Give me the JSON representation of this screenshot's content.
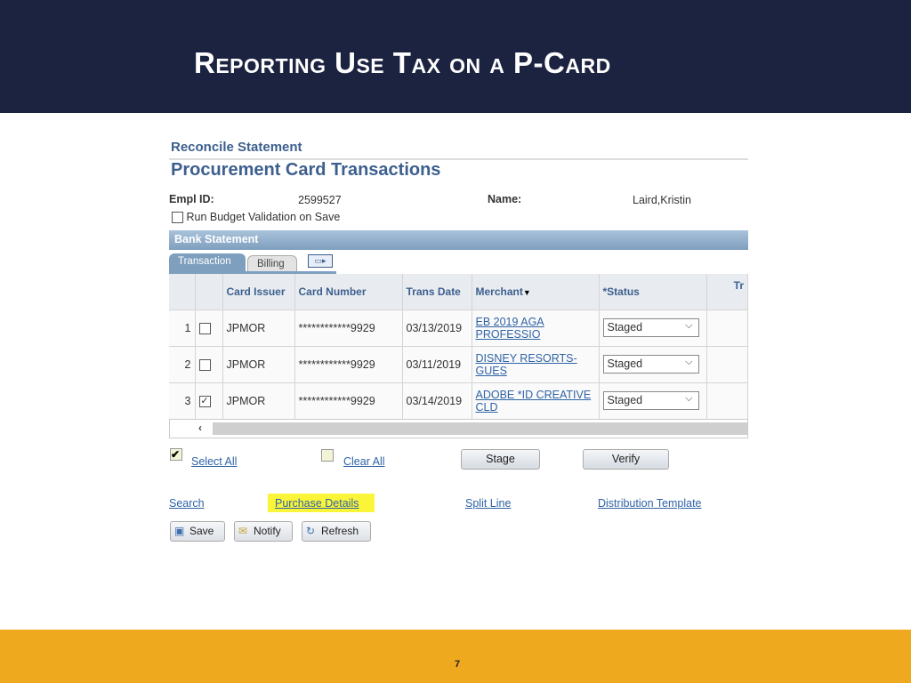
{
  "slide": {
    "title": "Reporting Use Tax on a P-Card",
    "page_number": "7"
  },
  "app": {
    "breadcrumb": "Reconcile Statement",
    "page_title": "Procurement Card Transactions",
    "empl_id_label": "Empl ID:",
    "empl_id": "2599527",
    "name_label": "Name:",
    "name": "Laird,Kristin",
    "budget_validation_label": "Run Budget Validation on Save",
    "budget_validation_checked": false,
    "section_title": "Bank Statement",
    "tabs": [
      {
        "label": "Transaction",
        "active": true
      },
      {
        "label": "Billing",
        "active": false
      }
    ],
    "grid_icon": "show-all-columns-icon",
    "columns": [
      "",
      "",
      "Card Issuer",
      "Card Number",
      "Trans Date",
      "Merchant",
      "*Status",
      "Tr"
    ],
    "rows": [
      {
        "num": "1",
        "checked": false,
        "issuer": "JPMOR",
        "card": "************9929",
        "date": "03/13/2019",
        "merchant": "EB 2019 AGA PROFESSIO",
        "status": "Staged"
      },
      {
        "num": "2",
        "checked": false,
        "issuer": "JPMOR",
        "card": "************9929",
        "date": "03/11/2019",
        "merchant": "DISNEY RESORTS-GUES",
        "status": "Staged"
      },
      {
        "num": "3",
        "checked": true,
        "issuer": "JPMOR",
        "card": "************9929",
        "date": "03/14/2019",
        "merchant": "ADOBE *ID CREATIVE CLD",
        "status": "Staged"
      }
    ],
    "select_all": "Select All",
    "clear_all": "Clear All",
    "stage": "Stage",
    "verify": "Verify",
    "links": {
      "search": "Search",
      "purchase_details": "Purchase Details",
      "split_line": "Split Line",
      "distribution_template": "Distribution Template"
    },
    "highlight_color": "#fbf53a",
    "save": "Save",
    "notify": "Notify",
    "refresh": "Refresh"
  },
  "colors": {
    "header": "#1c2340",
    "footer": "#efa91f",
    "link": "#2f63a6"
  }
}
